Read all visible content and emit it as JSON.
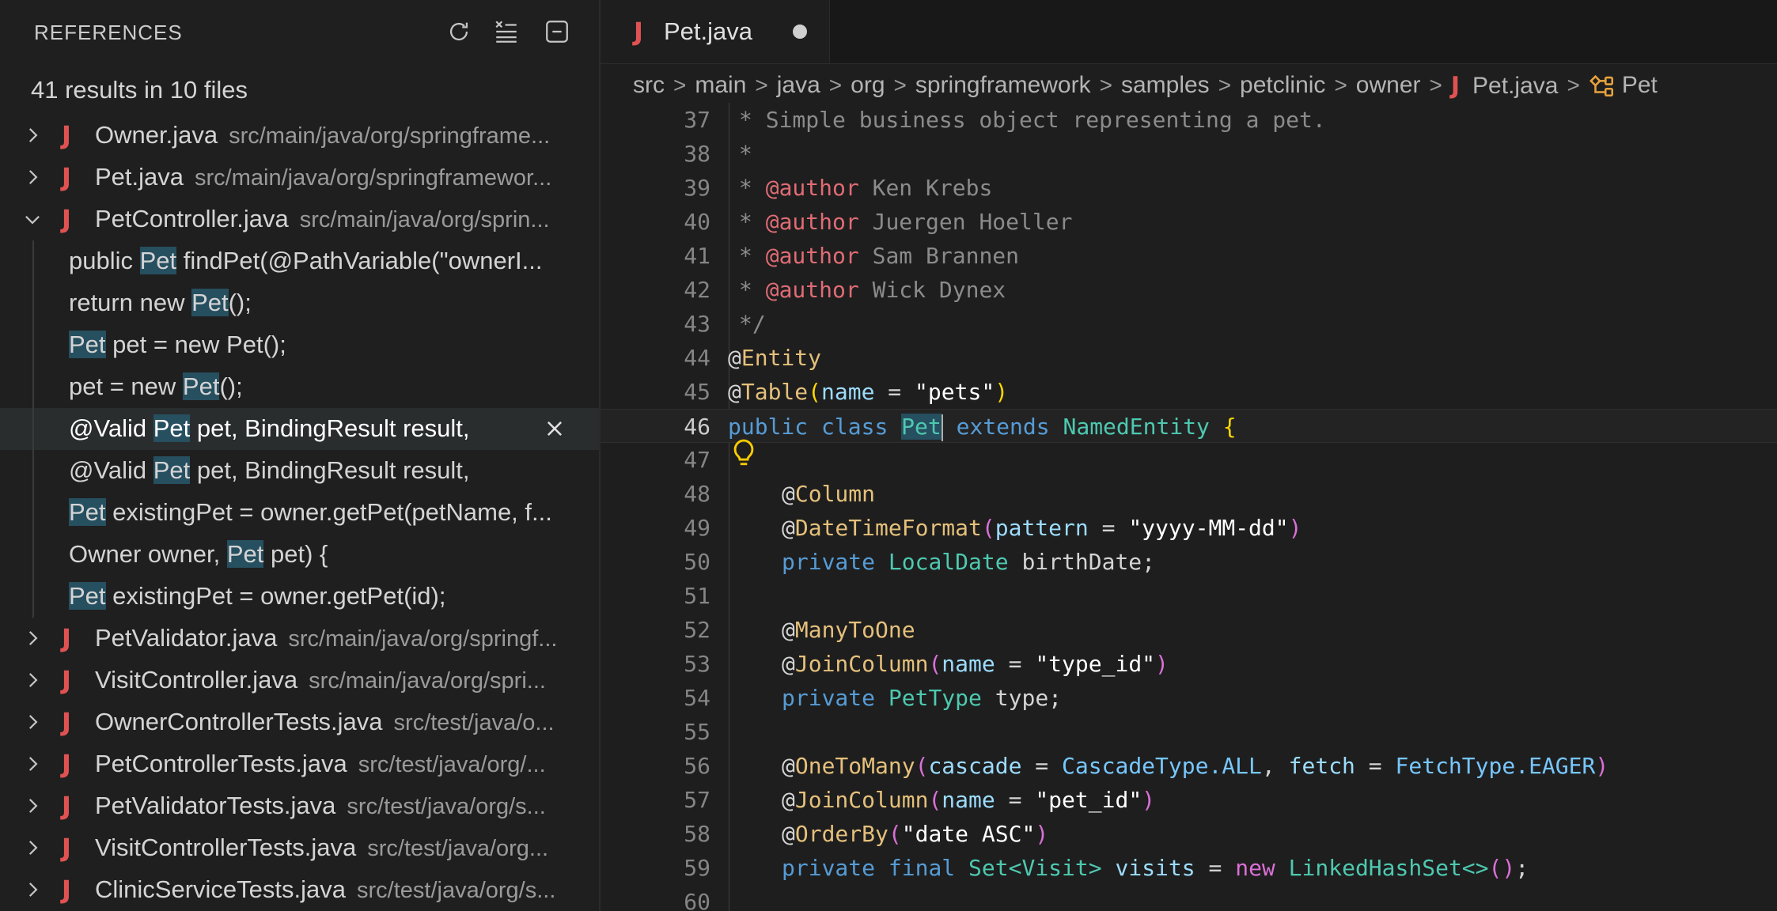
{
  "sidebar": {
    "title": "REFERENCES",
    "summary": "41 results in 10 files",
    "files": [
      {
        "name": "Owner.java",
        "path": "src/main/java/org/springframe..."
      },
      {
        "name": "Pet.java",
        "path": "src/main/java/org/springframewor..."
      },
      {
        "name": "PetController.java",
        "path": "src/main/java/org/sprin..."
      },
      {
        "name": "PetValidator.java",
        "path": "src/main/java/org/springf..."
      },
      {
        "name": "VisitController.java",
        "path": "src/main/java/org/spri..."
      },
      {
        "name": "OwnerControllerTests.java",
        "path": "src/test/java/o..."
      },
      {
        "name": "PetControllerTests.java",
        "path": "src/test/java/org/..."
      },
      {
        "name": "PetValidatorTests.java",
        "path": "src/test/java/org/s..."
      },
      {
        "name": "VisitControllerTests.java",
        "path": "src/test/java/org..."
      },
      {
        "name": "ClinicServiceTests.java",
        "path": "src/test/java/org/s..."
      }
    ],
    "matches": [
      {
        "pre": "public ",
        "hit": "Pet",
        "post": " findPet(@PathVariable(\"ownerI..."
      },
      {
        "pre": "return new ",
        "hit": "Pet",
        "post": "();"
      },
      {
        "pre": "",
        "hit": "Pet",
        "post": " pet = new Pet();"
      },
      {
        "pre": "pet = new ",
        "hit": "Pet",
        "post": "();"
      },
      {
        "pre": "@Valid ",
        "hit": "Pet",
        "post": " pet, BindingResult result,"
      },
      {
        "pre": "@Valid ",
        "hit": "Pet",
        "post": " pet, BindingResult result,"
      },
      {
        "pre": "",
        "hit": "Pet",
        "post": " existingPet = owner.getPet(petName, f..."
      },
      {
        "pre": "Owner owner, ",
        "hit": "Pet",
        "post": " pet) {"
      },
      {
        "pre": "",
        "hit": "Pet",
        "post": " existingPet = owner.getPet(id);"
      }
    ]
  },
  "tab": {
    "label": "Pet.java",
    "icon": "J"
  },
  "breadcrumb": [
    "src",
    "main",
    "java",
    "org",
    "springframework",
    "samples",
    "petclinic",
    "owner",
    "Pet.java",
    "Pet"
  ],
  "editor": {
    "line_numbers": [
      "37",
      "38",
      "39",
      "40",
      "41",
      "42",
      "43",
      "44",
      "45",
      "46",
      "47",
      "48",
      "49",
      "50",
      "51",
      "52",
      "53",
      "54",
      "55",
      "56",
      "57",
      "58",
      "59",
      "60"
    ],
    "comment_first": "* Simple business object representing a pet.",
    "authors": [
      "Ken Krebs",
      "Juergen Hoeller",
      "Sam Brannen",
      "Wick Dynex"
    ],
    "author_tag": "@author"
  }
}
